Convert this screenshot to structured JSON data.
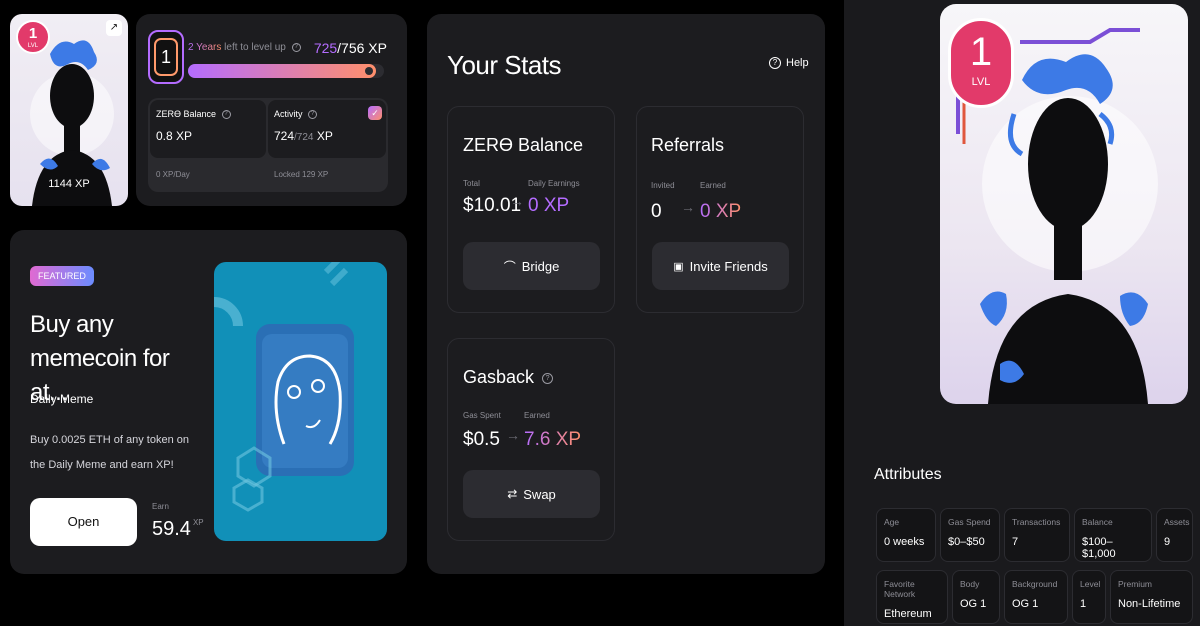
{
  "profile": {
    "level_number": "1",
    "level_label": "LVL",
    "xp_badge": "1144 XP",
    "big_level_number": "1",
    "big_level_label": "LVL"
  },
  "level_progress": {
    "level_box": "1",
    "time_left": "2 Years",
    "time_left_suffix": "left to level up",
    "xp_current": "725",
    "xp_total": "/756 XP",
    "progress": 0.96
  },
  "mini_stats": {
    "zero_balance_label": "ZERϴ Balance",
    "zero_balance_value": "0.8 XP",
    "zero_balance_rate": "0 XP/Day",
    "activity_label": "Activity",
    "activity_value": "724",
    "activity_total": "/724",
    "activity_unit": "XP",
    "activity_locked": "Locked 129 XP"
  },
  "featured": {
    "badge": "FEATURED",
    "title": "Buy any memecoin for at...",
    "subtitle": "Daily Meme",
    "description": "Buy 0.0025 ETH of any token on the Daily Meme and earn XP!",
    "open_button": "Open",
    "earn_label": "Earn",
    "earn_value": "59.4",
    "earn_unit": "XP"
  },
  "stats": {
    "title": "Your Stats",
    "help_label": "Help",
    "zero_balance": {
      "title": "ZERϴ Balance",
      "total_label": "Total",
      "total_value": "$10.01",
      "earnings_label": "Daily Earnings",
      "earnings_value": "0 XP",
      "button": "Bridge"
    },
    "referrals": {
      "title": "Referrals",
      "invited_label": "Invited",
      "invited_value": "0",
      "earned_label": "Earned",
      "earned_value": "0 XP",
      "button": "Invite Friends"
    },
    "gasback": {
      "title": "Gasback",
      "spent_label": "Gas Spent",
      "spent_value": "$0.5",
      "earned_label": "Earned",
      "earned_value": "7.6 XP",
      "button": "Swap"
    }
  },
  "attributes": {
    "title": "Attributes",
    "items": [
      {
        "key": "Age",
        "value": "0 weeks"
      },
      {
        "key": "Gas Spend",
        "value": "$0–$50"
      },
      {
        "key": "Transactions",
        "value": "7"
      },
      {
        "key": "Balance",
        "value": "$100–$1,000"
      },
      {
        "key": "Assets",
        "value": "9"
      },
      {
        "key": "Favorite Network",
        "value": "Ethereum"
      },
      {
        "key": "Body",
        "value": "OG 1"
      },
      {
        "key": "Background",
        "value": "OG 1"
      },
      {
        "key": "Level",
        "value": "1"
      },
      {
        "key": "Premium",
        "value": "Non-Lifetime"
      }
    ]
  },
  "colors": {
    "accent_purple": "#b46cff",
    "accent_orange": "#ff8f6b",
    "card_bg": "#1c1c1f",
    "featured_art_bg": "#1190b8"
  }
}
